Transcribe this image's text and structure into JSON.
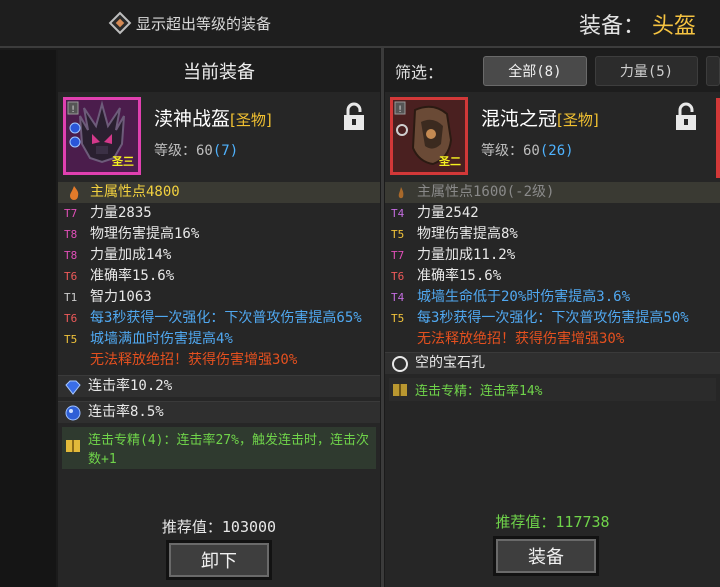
{
  "topbar": {
    "toggle_label": "显示超出等级的装备",
    "slot_label": "装备：",
    "slot_value": "头盔"
  },
  "current": {
    "header": "当前装备",
    "name": "渎神战盔",
    "tag": "[圣物]",
    "level_label": "等级：60",
    "level_count": "(7)",
    "ribbon": "圣三",
    "main_stat": "主属性点4800",
    "affixes": [
      {
        "tier": "T7",
        "text": "力量2835",
        "color": "white"
      },
      {
        "tier": "T8",
        "text": "物理伤害提高16%",
        "color": "white"
      },
      {
        "tier": "T8",
        "text": "力量加成14%",
        "color": "white"
      },
      {
        "tier": "T6",
        "text": "准确率15.6%",
        "color": "white"
      },
      {
        "tier": "T1",
        "text": "智力1063",
        "color": "white"
      },
      {
        "tier": "T6",
        "text": "每3秒获得一次强化：下次普攻伤害提高65%",
        "color": "blue"
      },
      {
        "tier": "T5",
        "text": "城墙满血时伤害提高4%",
        "color": "blue"
      }
    ],
    "curse": "无法释放绝招！获得伤害增强30%",
    "gems": [
      "连击率10.2%",
      "连击率8.5%"
    ],
    "set_bonus": "连击专精(4)：连击率27%，触发连击时，连击次数+1",
    "recommend": "推荐值：103000",
    "action": "卸下"
  },
  "compare": {
    "filter_label": "筛选：",
    "tabs": [
      "全部(8)",
      "力量(5)",
      ""
    ],
    "name": "混沌之冠",
    "tag": "[圣物]",
    "level_label": "等级：60",
    "level_count": "(26)",
    "ribbon": "圣二",
    "main_stat": "主属性点1600(-2级)",
    "affixes": [
      {
        "tier": "T4",
        "text": "力量2542",
        "color": "white"
      },
      {
        "tier": "T5",
        "text": "物理伤害提高8%",
        "color": "white"
      },
      {
        "tier": "T7",
        "text": "力量加成11.2%",
        "color": "white"
      },
      {
        "tier": "T6",
        "text": "准确率15.6%",
        "color": "white"
      },
      {
        "tier": "T4",
        "text": "城墙生命低于20%时伤害提高3.6%",
        "color": "blue"
      },
      {
        "tier": "T5",
        "text": "每3秒获得一次强化：下次普攻伤害提高50%",
        "color": "blue"
      }
    ],
    "curse": "无法释放绝招！获得伤害增强30%",
    "gem_slot": "空的宝石孔",
    "set_bonus": "连击专精：连击率14%",
    "recommend": "推荐值：117738",
    "action": "装备"
  },
  "colors": {
    "accent_gold": "#f2c131",
    "legendary_border": "#e040b0",
    "red_border": "#d23838",
    "affix_blue": "#50a8f0",
    "curse_red": "#e4501f",
    "set_green": "#6fd34a"
  }
}
